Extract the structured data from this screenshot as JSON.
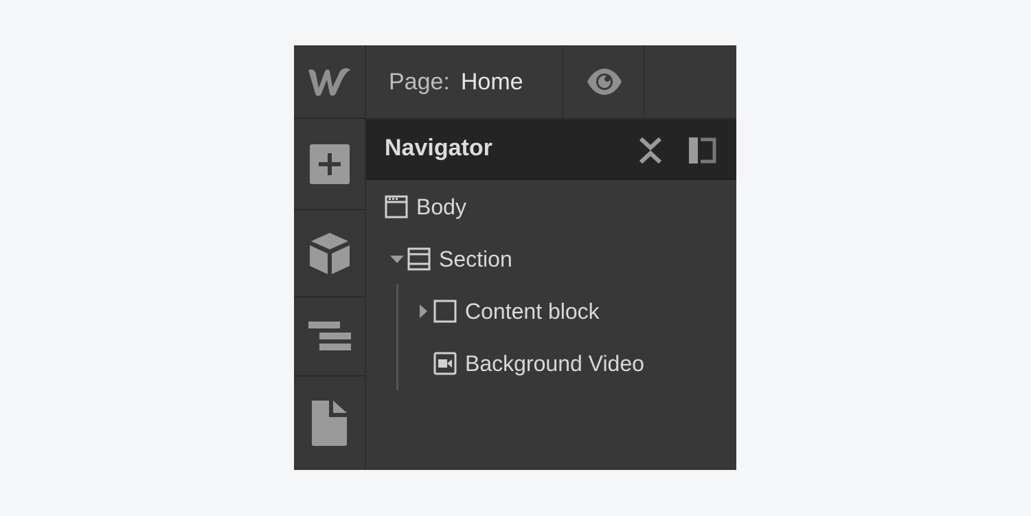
{
  "app": {
    "logo": "webflow-logo",
    "accent_color": "#242424"
  },
  "topbar": {
    "page_label": "Page:",
    "page_name": "Home",
    "preview_icon": "eye-icon"
  },
  "rail": {
    "items": [
      {
        "name": "add-panel",
        "icon": "plus-icon"
      },
      {
        "name": "components",
        "icon": "cube-icon"
      },
      {
        "name": "navigator",
        "icon": "navigator-icon"
      },
      {
        "name": "pages",
        "icon": "page-icon"
      }
    ]
  },
  "navigator": {
    "title": "Navigator",
    "collapse_icon": "collapse-icon",
    "dock_icon": "dock-panel-icon",
    "tree": [
      {
        "label": "Body",
        "icon": "body-icon",
        "level": 0,
        "expander": "none"
      },
      {
        "label": "Section",
        "icon": "section-icon",
        "level": 1,
        "expander": "expanded"
      },
      {
        "label": "Content block",
        "icon": "div-block-icon",
        "level": 2,
        "expander": "collapsed"
      },
      {
        "label": "Background Video",
        "icon": "video-icon",
        "level": 2,
        "expander": "none"
      }
    ]
  }
}
